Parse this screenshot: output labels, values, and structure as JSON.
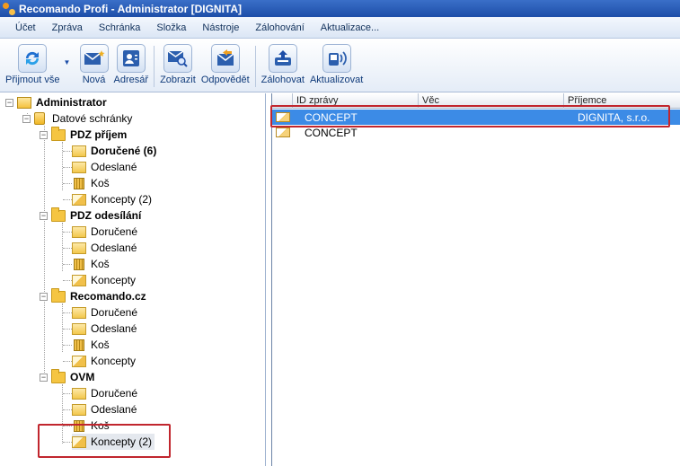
{
  "window": {
    "title": "Recomando Profi - Administrator [DIGNITA]"
  },
  "menu": [
    "Účet",
    "Zpráva",
    "Schránka",
    "Složka",
    "Nástroje",
    "Zálohování",
    "Aktualizace..."
  ],
  "toolbar": {
    "receive_all": "Přijmout vše",
    "new": "Nová",
    "address_book": "Adresář",
    "show": "Zobrazit",
    "reply": "Odpovědět",
    "backup": "Zálohovat",
    "update": "Aktualizovat"
  },
  "tree": {
    "root": "Administrator",
    "datove_schranky": "Datové schránky",
    "groups": [
      {
        "name": "PDZ příjem",
        "items": [
          "Doručené (6)",
          "Odeslané",
          "Koš",
          "Koncepty (2)"
        ]
      },
      {
        "name": "PDZ odesílání",
        "items": [
          "Doručené",
          "Odeslané",
          "Koš",
          "Koncepty"
        ]
      },
      {
        "name": "Recomando.cz",
        "items": [
          "Doručené",
          "Odeslané",
          "Koš",
          "Koncepty"
        ]
      },
      {
        "name": "OVM",
        "items": [
          "Doručené",
          "Odeslané",
          "Koš",
          "Koncepty (2)"
        ]
      }
    ]
  },
  "grid": {
    "columns": [
      "ID zprávy",
      "Věc",
      "Příjemce"
    ],
    "rows": [
      {
        "id": "CONCEPT",
        "subject": "",
        "recipient": "DIGNITA, s.r.o.",
        "selected": true
      },
      {
        "id": "CONCEPT",
        "subject": "",
        "recipient": "",
        "selected": false
      }
    ]
  },
  "colors": {
    "selection": "#3c8be6",
    "highlight_box": "#c1262e",
    "titlebar": "#1d4ea8"
  }
}
